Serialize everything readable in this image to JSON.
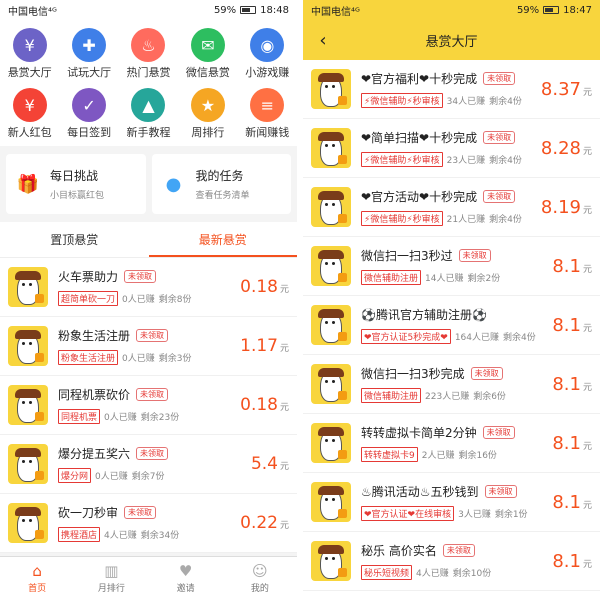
{
  "left": {
    "status": {
      "carrier": "中国电信",
      "signal": "⁴ᴳ",
      "battery": "59%",
      "time": "18:48"
    },
    "grid": [
      {
        "label": "悬赏大厅",
        "icon": "money-bag-icon",
        "color": "#6c63c7",
        "glyph": "¥"
      },
      {
        "label": "试玩大厅",
        "icon": "gamepad-icon",
        "color": "#3f7fe8",
        "glyph": "✚"
      },
      {
        "label": "热门悬赏",
        "icon": "flame-icon",
        "color": "#ff6b5e",
        "glyph": "♨"
      },
      {
        "label": "微信悬赏",
        "icon": "wechat-icon",
        "color": "#2dbe60",
        "glyph": "✉"
      },
      {
        "label": "小游戏赚",
        "icon": "controller-icon",
        "color": "#3f7fe8",
        "glyph": "◉"
      },
      {
        "label": "新人红包",
        "icon": "red-packet-icon",
        "color": "#f44336",
        "glyph": "¥"
      },
      {
        "label": "每日签到",
        "icon": "calendar-icon",
        "color": "#7e57c2",
        "glyph": "✓"
      },
      {
        "label": "新手教程",
        "icon": "graduation-cap-icon",
        "color": "#26a69a",
        "glyph": "▲"
      },
      {
        "label": "周排行",
        "icon": "trophy-icon",
        "color": "#f5a623",
        "glyph": "★"
      },
      {
        "label": "新闻赚钱",
        "icon": "news-icon",
        "color": "#ff7043",
        "glyph": "≡"
      }
    ],
    "cards": [
      {
        "title": "每日挑战",
        "sub": "小目标赢红包",
        "icon": "gift-icon",
        "color": "#f4511e",
        "glyph": "🎁"
      },
      {
        "title": "我的任务",
        "sub": "查看任务清单",
        "icon": "user-task-icon",
        "color": "#42a5f5",
        "glyph": "●"
      }
    ],
    "tabs": [
      {
        "label": "置顶悬赏"
      },
      {
        "label": "最新悬赏"
      }
    ],
    "rows": [
      {
        "title": "火车票助力",
        "badge": "未领取",
        "tag": "超简单砍一刀",
        "earned": "0人已赚",
        "left": "剩余8份",
        "price": "0.18",
        "unit": "元"
      },
      {
        "title": "粉象生活注册",
        "badge": "未领取",
        "tag": "粉象生活注册",
        "earned": "0人已赚",
        "left": "剩余3份",
        "price": "1.17",
        "unit": "元"
      },
      {
        "title": "同程机票砍价",
        "badge": "未领取",
        "tag": "同程机票",
        "earned": "0人已赚",
        "left": "剩余23份",
        "price": "0.18",
        "unit": "元"
      },
      {
        "title": "爆分提五奖六",
        "badge": "未领取",
        "tag": "爆分网",
        "earned": "0人已赚",
        "left": "剩余7份",
        "price": "5.4",
        "unit": "元"
      },
      {
        "title": "砍一刀秒审",
        "badge": "未领取",
        "tag": "携程酒店",
        "earned": "4人已赚",
        "left": "剩余34份",
        "price": "0.22",
        "unit": "元"
      }
    ],
    "nav": [
      {
        "label": "首页",
        "icon": "home-icon",
        "glyph": "⌂"
      },
      {
        "label": "月排行",
        "icon": "ranking-icon",
        "glyph": "▥"
      },
      {
        "label": "邀请",
        "icon": "invite-icon",
        "glyph": "♥"
      },
      {
        "label": "我的",
        "icon": "profile-icon",
        "glyph": "☺"
      }
    ]
  },
  "right": {
    "status": {
      "carrier": "中国电信",
      "signal": "⁴ᴳ",
      "battery": "59%",
      "time": "18:47"
    },
    "title": "悬赏大厅",
    "rows": [
      {
        "title": "❤官方福利❤十秒完成",
        "badge": "未领取",
        "tag": "⚡微信辅助⚡秒审核",
        "earned": "34人已赚",
        "left": "剩余4份",
        "price": "8.37",
        "unit": "元"
      },
      {
        "title": "❤简单扫描❤十秒完成",
        "badge": "未领取",
        "tag": "⚡微信辅助⚡秒审核",
        "earned": "23人已赚",
        "left": "剩余4份",
        "price": "8.28",
        "unit": "元"
      },
      {
        "title": "❤官方活动❤十秒完成",
        "badge": "未领取",
        "tag": "⚡微信辅助⚡秒审核",
        "earned": "21人已赚",
        "left": "剩余4份",
        "price": "8.19",
        "unit": "元"
      },
      {
        "title": "微信扫一扫3秒过",
        "badge": "未领取",
        "tag": "微信辅助注册",
        "earned": "14人已赚",
        "left": "剩余2份",
        "price": "8.1",
        "unit": "元"
      },
      {
        "title": "⚽腾讯官方辅助注册⚽",
        "badge": "",
        "tag": "❤官方认证5秒完成❤",
        "earned": "164人已赚",
        "left": "剩余4份",
        "price": "8.1",
        "unit": "元"
      },
      {
        "title": "微信扫一扫3秒完成",
        "badge": "未领取",
        "tag": "微信辅助注册",
        "earned": "223人已赚",
        "left": "剩余6份",
        "price": "8.1",
        "unit": "元"
      },
      {
        "title": "转转虚拟卡简单2分钟",
        "badge": "未领取",
        "tag": "转转虚拟卡9",
        "earned": "2人已赚",
        "left": "剩余16份",
        "price": "8.1",
        "unit": "元"
      },
      {
        "title": "♨腾讯活动♨五秒钱到",
        "badge": "未领取",
        "tag": "❤官方认证❤在线审核",
        "earned": "3人已赚",
        "left": "剩余1份",
        "price": "8.1",
        "unit": "元"
      },
      {
        "title": "秘乐 高价实名",
        "badge": "未领取",
        "tag": "秘乐短视频",
        "earned": "4人已赚",
        "left": "剩余10份",
        "price": "8.1",
        "unit": "元"
      }
    ]
  }
}
